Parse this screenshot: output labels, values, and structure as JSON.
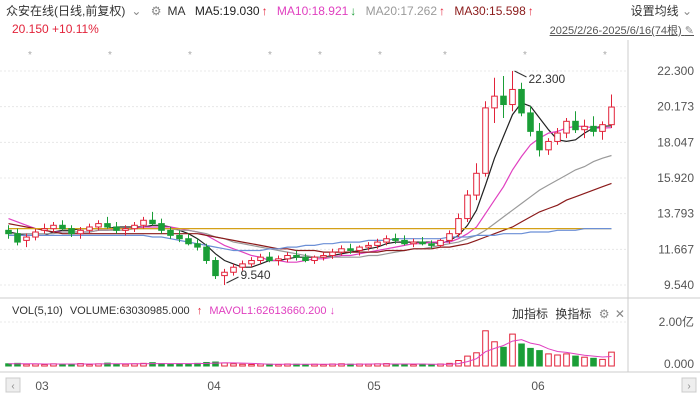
{
  "header": {
    "title": "众安在线(日线,前复权)",
    "dropdown_icon": "chevron-down-icon",
    "ma_label": "MA",
    "ma5": "MA5:19.030",
    "ma10": "MA10:18.921",
    "ma20": "MA20:17.262",
    "ma30": "MA30:15.598",
    "settings_label": "设置均线",
    "price_change": "20.150 +10.11%",
    "date_range": "2025/2/26-2025/6/16(74根)"
  },
  "colors": {
    "up": "#e2233a",
    "down": "#1a9e37",
    "ma5": "#222222",
    "ma10": "#e040c0",
    "ma20": "#9a9a9a",
    "ma30": "#8b1a1a",
    "yellow_line": "#d4a017",
    "blue_line": "#6b8fd6"
  },
  "main_axis": {
    "labels": [
      "22.300",
      "20.173",
      "18.047",
      "15.920",
      "13.793",
      "11.667",
      "9.540"
    ],
    "min": 9.54,
    "max": 22.3
  },
  "annotations": {
    "high": "22.300",
    "low": "9.540"
  },
  "volume": {
    "header_vol": "VOL(5,10)",
    "header_volume": "VOLUME:63030985.000",
    "header_mavol1": "MAVOL1:62613660.200",
    "add_indicator": "加指标",
    "switch_indicator": "换指标",
    "axis_labels": [
      "2.00亿",
      "0.000"
    ]
  },
  "x_axis": {
    "labels": [
      "03",
      "04",
      "05",
      "06"
    ]
  },
  "chart_data": {
    "type": "candlestick",
    "series": [
      {
        "name": "K",
        "ohlc": [
          [
            12.8,
            13.1,
            12.3,
            12.6
          ],
          [
            12.6,
            12.9,
            11.9,
            12.1
          ],
          [
            12.2,
            12.6,
            11.8,
            12.4
          ],
          [
            12.4,
            12.9,
            12.2,
            12.7
          ],
          [
            12.8,
            13.2,
            12.6,
            12.9
          ],
          [
            12.9,
            13.3,
            12.7,
            13.1
          ],
          [
            13.1,
            13.4,
            12.8,
            12.9
          ],
          [
            12.9,
            13.1,
            12.4,
            12.6
          ],
          [
            12.6,
            13.0,
            12.3,
            12.8
          ],
          [
            12.8,
            13.2,
            12.6,
            13.0
          ],
          [
            13.0,
            13.4,
            12.8,
            13.2
          ],
          [
            13.2,
            13.6,
            12.9,
            13.0
          ],
          [
            13.0,
            13.3,
            12.6,
            12.8
          ],
          [
            12.8,
            13.1,
            12.5,
            12.9
          ],
          [
            12.9,
            13.3,
            12.7,
            13.1
          ],
          [
            13.1,
            13.6,
            12.9,
            13.4
          ],
          [
            13.4,
            13.9,
            13.1,
            13.2
          ],
          [
            13.2,
            13.5,
            12.6,
            12.8
          ],
          [
            12.8,
            13.0,
            12.3,
            12.5
          ],
          [
            12.5,
            12.8,
            12.1,
            12.3
          ],
          [
            12.3,
            12.6,
            11.9,
            12.0
          ],
          [
            12.0,
            12.3,
            11.6,
            11.8
          ],
          [
            11.8,
            12.0,
            10.8,
            11.0
          ],
          [
            11.0,
            11.2,
            9.9,
            10.1
          ],
          [
            10.1,
            10.5,
            9.54,
            10.3
          ],
          [
            10.3,
            10.8,
            10.1,
            10.6
          ],
          [
            10.6,
            11.0,
            10.4,
            10.8
          ],
          [
            10.8,
            11.2,
            10.6,
            11.0
          ],
          [
            11.0,
            11.4,
            10.8,
            11.2
          ],
          [
            11.2,
            11.5,
            10.9,
            11.0
          ],
          [
            11.0,
            11.3,
            10.7,
            11.1
          ],
          [
            11.1,
            11.5,
            10.9,
            11.3
          ],
          [
            11.3,
            11.6,
            11.0,
            11.2
          ],
          [
            11.2,
            11.4,
            10.9,
            11.0
          ],
          [
            11.0,
            11.3,
            10.8,
            11.2
          ],
          [
            11.2,
            11.5,
            11.0,
            11.3
          ],
          [
            11.3,
            11.7,
            11.1,
            11.5
          ],
          [
            11.5,
            11.9,
            11.3,
            11.7
          ],
          [
            11.7,
            12.0,
            11.4,
            11.6
          ],
          [
            11.6,
            11.9,
            11.3,
            11.8
          ],
          [
            11.8,
            12.1,
            11.6,
            11.9
          ],
          [
            11.9,
            12.3,
            11.7,
            12.1
          ],
          [
            12.1,
            12.5,
            11.9,
            12.3
          ],
          [
            12.3,
            12.6,
            12.0,
            12.2
          ],
          [
            12.2,
            12.5,
            11.9,
            12.0
          ],
          [
            12.0,
            12.3,
            11.8,
            12.1
          ],
          [
            12.1,
            12.4,
            11.9,
            12.0
          ],
          [
            12.0,
            12.2,
            11.7,
            11.9
          ],
          [
            11.9,
            12.3,
            11.8,
            12.2
          ],
          [
            12.2,
            12.8,
            12.0,
            12.6
          ],
          [
            12.6,
            13.8,
            12.4,
            13.5
          ],
          [
            13.5,
            15.2,
            13.3,
            14.9
          ],
          [
            14.9,
            16.8,
            14.6,
            16.2
          ],
          [
            16.2,
            20.5,
            16.0,
            20.1
          ],
          [
            20.1,
            21.9,
            19.2,
            20.8
          ],
          [
            20.8,
            22.0,
            19.5,
            20.3
          ],
          [
            20.3,
            22.3,
            19.9,
            21.2
          ],
          [
            21.2,
            21.6,
            19.6,
            19.8
          ],
          [
            19.8,
            20.2,
            18.4,
            18.7
          ],
          [
            18.7,
            19.2,
            17.2,
            17.6
          ],
          [
            17.6,
            18.3,
            17.3,
            18.1
          ],
          [
            18.1,
            18.9,
            17.9,
            18.6
          ],
          [
            18.6,
            19.5,
            18.3,
            19.3
          ],
          [
            19.3,
            19.9,
            18.6,
            18.8
          ],
          [
            18.8,
            19.4,
            18.3,
            19.0
          ],
          [
            19.0,
            19.6,
            18.4,
            18.7
          ],
          [
            18.7,
            19.3,
            18.2,
            19.1
          ],
          [
            19.1,
            20.9,
            18.9,
            20.15
          ]
        ]
      },
      {
        "name": "MA5",
        "values": [
          12.7,
          12.6,
          12.5,
          12.5,
          12.5,
          12.7,
          12.8,
          12.8,
          12.9,
          12.9,
          12.9,
          12.9,
          13.0,
          13.0,
          13.0,
          13.0,
          13.1,
          13.1,
          13.0,
          12.8,
          12.6,
          12.3,
          11.9,
          11.4,
          11.0,
          10.8,
          10.6,
          10.6,
          10.8,
          11.0,
          11.0,
          11.1,
          11.2,
          11.2,
          11.2,
          11.2,
          11.3,
          11.4,
          11.5,
          11.6,
          11.7,
          11.8,
          12.0,
          12.1,
          12.1,
          12.1,
          12.1,
          12.1,
          12.0,
          12.2,
          12.5,
          13.1,
          14.0,
          15.5,
          17.1,
          18.4,
          19.7,
          20.4,
          20.2,
          19.5,
          18.8,
          18.2,
          18.1,
          18.2,
          18.6,
          18.9,
          19.0,
          19.03
        ]
      },
      {
        "name": "MA10",
        "values": [
          13.5,
          13.3,
          13.1,
          12.9,
          12.8,
          12.7,
          12.7,
          12.7,
          12.7,
          12.7,
          12.8,
          12.8,
          12.9,
          12.9,
          12.9,
          13.0,
          13.0,
          13.0,
          13.0,
          12.9,
          12.8,
          12.7,
          12.5,
          12.2,
          11.9,
          11.7,
          11.5,
          11.3,
          11.2,
          11.0,
          11.0,
          10.9,
          10.9,
          11.0,
          11.1,
          11.1,
          11.2,
          11.3,
          11.3,
          11.4,
          11.5,
          11.6,
          11.7,
          11.8,
          11.9,
          12.0,
          12.0,
          12.1,
          12.1,
          12.1,
          12.3,
          12.6,
          13.0,
          13.8,
          14.6,
          15.4,
          16.4,
          17.2,
          17.9,
          18.3,
          18.6,
          18.7,
          18.9,
          19.0,
          19.0,
          18.9,
          18.9,
          18.92
        ]
      },
      {
        "name": "MA20",
        "values": [
          12.6,
          12.6,
          12.6,
          12.6,
          12.6,
          12.6,
          12.7,
          12.7,
          12.7,
          12.7,
          12.8,
          12.8,
          12.8,
          12.8,
          12.9,
          12.9,
          12.9,
          12.9,
          12.9,
          12.8,
          12.8,
          12.7,
          12.6,
          12.4,
          12.3,
          12.1,
          12.0,
          11.9,
          11.8,
          11.7,
          11.6,
          11.5,
          11.4,
          11.3,
          11.2,
          11.2,
          11.2,
          11.2,
          11.2,
          11.2,
          11.3,
          11.3,
          11.4,
          11.5,
          11.6,
          11.7,
          11.7,
          11.8,
          11.9,
          12.0,
          12.1,
          12.3,
          12.5,
          12.8,
          13.2,
          13.6,
          14.0,
          14.4,
          14.8,
          15.2,
          15.5,
          15.8,
          16.1,
          16.4,
          16.6,
          16.9,
          17.1,
          17.26
        ]
      },
      {
        "name": "MA30",
        "values": [
          13.2,
          13.1,
          13.0,
          12.9,
          12.8,
          12.7,
          12.6,
          12.6,
          12.6,
          12.6,
          12.6,
          12.6,
          12.6,
          12.6,
          12.6,
          12.6,
          12.6,
          12.6,
          12.6,
          12.6,
          12.6,
          12.6,
          12.5,
          12.4,
          12.3,
          12.2,
          12.1,
          12.0,
          11.9,
          11.8,
          11.7,
          11.7,
          11.6,
          11.6,
          11.6,
          11.5,
          11.5,
          11.5,
          11.5,
          11.5,
          11.5,
          11.5,
          11.6,
          11.6,
          11.6,
          11.7,
          11.7,
          11.7,
          11.8,
          11.8,
          11.9,
          12.0,
          12.2,
          12.4,
          12.6,
          12.8,
          13.0,
          13.3,
          13.6,
          13.9,
          14.1,
          14.3,
          14.6,
          14.8,
          15.0,
          15.2,
          15.4,
          15.6
        ]
      },
      {
        "name": "",
        "values": [
          12.9,
          12.9,
          12.9,
          12.9,
          12.9,
          12.9,
          12.9,
          12.9,
          12.9,
          12.9,
          12.9,
          12.9,
          12.9,
          12.9,
          12.9,
          12.9,
          12.9,
          12.9,
          12.9,
          12.9,
          12.9,
          12.9,
          12.9,
          12.9,
          12.9,
          12.9,
          12.9,
          12.9,
          12.9,
          12.9,
          12.9,
          12.9,
          12.9,
          12.9,
          12.9,
          12.9,
          12.9,
          12.9,
          12.9,
          12.9,
          12.9,
          12.9,
          12.9,
          12.9,
          12.9,
          12.9,
          12.9,
          12.9,
          12.9,
          12.9,
          12.9,
          12.9,
          12.9,
          12.9,
          12.9,
          12.9,
          12.9,
          12.9,
          12.9,
          12.9,
          12.9,
          12.9,
          12.9,
          12.9,
          12.9,
          12.9,
          12.9,
          12.9
        ]
      },
      {
        "name": "",
        "values": [
          12.5,
          12.5,
          12.5,
          12.5,
          12.5,
          12.5,
          12.5,
          12.5,
          12.5,
          12.5,
          12.5,
          12.5,
          12.5,
          12.5,
          12.5,
          12.5,
          12.4,
          12.4,
          12.3,
          12.2,
          12.1,
          12.0,
          11.9,
          11.8,
          11.7,
          11.6,
          11.6,
          11.6,
          11.6,
          11.7,
          11.7,
          11.8,
          11.8,
          11.9,
          11.9,
          12.0,
          12.0,
          12.1,
          12.1,
          12.1,
          12.2,
          12.2,
          12.2,
          12.3,
          12.3,
          12.3,
          12.3,
          12.3,
          12.3,
          12.4,
          12.4,
          12.4,
          12.5,
          12.5,
          12.5,
          12.6,
          12.6,
          12.6,
          12.7,
          12.7,
          12.7,
          12.8,
          12.8,
          12.8,
          12.9,
          12.9,
          12.9,
          12.9
        ]
      }
    ],
    "volume": [
      0.1,
      0.12,
      0.08,
      0.09,
      0.07,
      0.1,
      0.09,
      0.08,
      0.11,
      0.07,
      0.1,
      0.13,
      0.09,
      0.08,
      0.1,
      0.12,
      0.15,
      0.11,
      0.09,
      0.1,
      0.09,
      0.12,
      0.16,
      0.18,
      0.14,
      0.1,
      0.08,
      0.07,
      0.09,
      0.08,
      0.07,
      0.09,
      0.08,
      0.07,
      0.08,
      0.07,
      0.09,
      0.1,
      0.08,
      0.09,
      0.08,
      0.1,
      0.11,
      0.09,
      0.08,
      0.07,
      0.08,
      0.07,
      0.09,
      0.12,
      0.25,
      0.45,
      0.6,
      1.6,
      1.1,
      0.85,
      1.45,
      1.0,
      0.8,
      0.7,
      0.55,
      0.5,
      0.55,
      0.45,
      0.4,
      0.35,
      0.3,
      0.63
    ],
    "mavol": [
      0.1,
      0.1,
      0.1,
      0.1,
      0.09,
      0.09,
      0.09,
      0.09,
      0.09,
      0.09,
      0.09,
      0.1,
      0.1,
      0.1,
      0.1,
      0.1,
      0.11,
      0.11,
      0.11,
      0.11,
      0.11,
      0.11,
      0.12,
      0.13,
      0.14,
      0.14,
      0.13,
      0.12,
      0.1,
      0.08,
      0.08,
      0.08,
      0.08,
      0.08,
      0.08,
      0.08,
      0.08,
      0.08,
      0.08,
      0.08,
      0.09,
      0.09,
      0.09,
      0.09,
      0.09,
      0.09,
      0.09,
      0.08,
      0.08,
      0.08,
      0.11,
      0.2,
      0.33,
      0.65,
      0.8,
      0.93,
      1.13,
      1.2,
      1.04,
      0.96,
      0.78,
      0.66,
      0.62,
      0.55,
      0.49,
      0.45,
      0.41,
      0.43
    ],
    "ylim": [
      9.54,
      22.3
    ],
    "xlabels": [
      "03",
      "04",
      "05",
      "06"
    ]
  }
}
